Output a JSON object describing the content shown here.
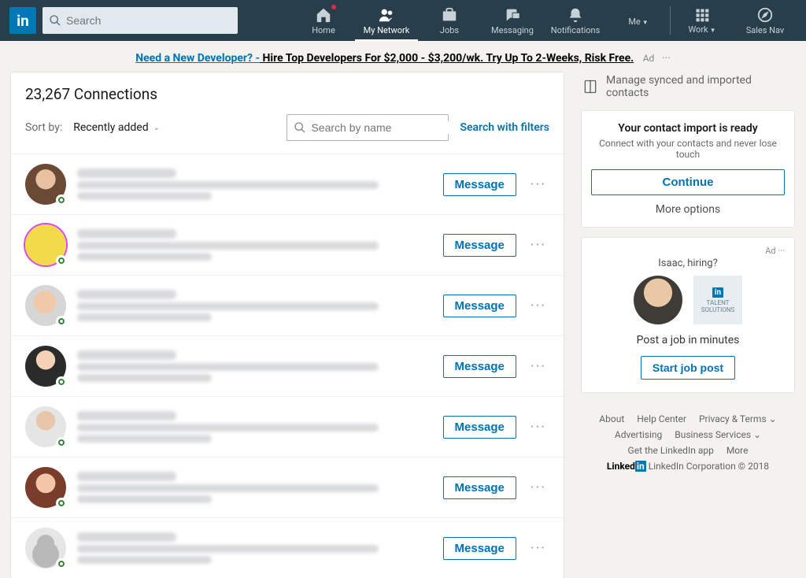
{
  "nav": {
    "search_placeholder": "Search",
    "items": {
      "home": "Home",
      "network": "My Network",
      "jobs": "Jobs",
      "messaging": "Messaging",
      "notifications": "Notifications",
      "me": "Me",
      "work": "Work",
      "salesnav": "Sales Nav"
    }
  },
  "ad_banner": {
    "lead": "Need a New Developer? -",
    "rest": " Hire Top Developers For $2,000 - $3,200/wk. Try Up To 2-Weeks, Risk Free.",
    "label": "Ad"
  },
  "connections": {
    "count_text": "23,267 Connections",
    "sort_label": "Sort by:",
    "sort_value": "Recently added",
    "search_placeholder": "Search by name",
    "filters_link": "Search with filters",
    "message_label": "Message"
  },
  "sidebar": {
    "manage": "Manage synced and imported contacts",
    "import": {
      "title": "Your contact import is ready",
      "subtitle": "Connect with your contacts and never lose touch",
      "cta": "Continue",
      "more": "More options"
    },
    "promo": {
      "ad_label": "Ad",
      "question": "Isaac, hiring?",
      "tile_text": "TALENT SOLUTIONS",
      "line": "Post a job in minutes",
      "cta": "Start job post"
    }
  },
  "footer": {
    "links": {
      "about": "About",
      "help": "Help Center",
      "privacy": "Privacy & Terms",
      "advertising": "Advertising",
      "business": "Business Services",
      "app": "Get the LinkedIn app",
      "more": "More"
    },
    "corp": "LinkedIn Corporation © 2018"
  }
}
